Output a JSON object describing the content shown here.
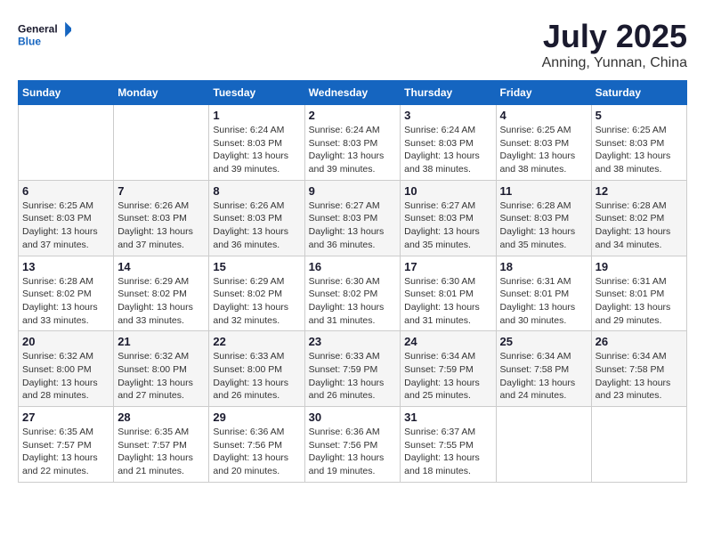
{
  "header": {
    "logo_line1": "General",
    "logo_line2": "Blue",
    "month_year": "July 2025",
    "location": "Anning, Yunnan, China"
  },
  "weekdays": [
    "Sunday",
    "Monday",
    "Tuesday",
    "Wednesday",
    "Thursday",
    "Friday",
    "Saturday"
  ],
  "weeks": [
    [
      {
        "day": "",
        "info": ""
      },
      {
        "day": "",
        "info": ""
      },
      {
        "day": "1",
        "info": "Sunrise: 6:24 AM\nSunset: 8:03 PM\nDaylight: 13 hours and 39 minutes."
      },
      {
        "day": "2",
        "info": "Sunrise: 6:24 AM\nSunset: 8:03 PM\nDaylight: 13 hours and 39 minutes."
      },
      {
        "day": "3",
        "info": "Sunrise: 6:24 AM\nSunset: 8:03 PM\nDaylight: 13 hours and 38 minutes."
      },
      {
        "day": "4",
        "info": "Sunrise: 6:25 AM\nSunset: 8:03 PM\nDaylight: 13 hours and 38 minutes."
      },
      {
        "day": "5",
        "info": "Sunrise: 6:25 AM\nSunset: 8:03 PM\nDaylight: 13 hours and 38 minutes."
      }
    ],
    [
      {
        "day": "6",
        "info": "Sunrise: 6:25 AM\nSunset: 8:03 PM\nDaylight: 13 hours and 37 minutes."
      },
      {
        "day": "7",
        "info": "Sunrise: 6:26 AM\nSunset: 8:03 PM\nDaylight: 13 hours and 37 minutes."
      },
      {
        "day": "8",
        "info": "Sunrise: 6:26 AM\nSunset: 8:03 PM\nDaylight: 13 hours and 36 minutes."
      },
      {
        "day": "9",
        "info": "Sunrise: 6:27 AM\nSunset: 8:03 PM\nDaylight: 13 hours and 36 minutes."
      },
      {
        "day": "10",
        "info": "Sunrise: 6:27 AM\nSunset: 8:03 PM\nDaylight: 13 hours and 35 minutes."
      },
      {
        "day": "11",
        "info": "Sunrise: 6:28 AM\nSunset: 8:03 PM\nDaylight: 13 hours and 35 minutes."
      },
      {
        "day": "12",
        "info": "Sunrise: 6:28 AM\nSunset: 8:02 PM\nDaylight: 13 hours and 34 minutes."
      }
    ],
    [
      {
        "day": "13",
        "info": "Sunrise: 6:28 AM\nSunset: 8:02 PM\nDaylight: 13 hours and 33 minutes."
      },
      {
        "day": "14",
        "info": "Sunrise: 6:29 AM\nSunset: 8:02 PM\nDaylight: 13 hours and 33 minutes."
      },
      {
        "day": "15",
        "info": "Sunrise: 6:29 AM\nSunset: 8:02 PM\nDaylight: 13 hours and 32 minutes."
      },
      {
        "day": "16",
        "info": "Sunrise: 6:30 AM\nSunset: 8:02 PM\nDaylight: 13 hours and 31 minutes."
      },
      {
        "day": "17",
        "info": "Sunrise: 6:30 AM\nSunset: 8:01 PM\nDaylight: 13 hours and 31 minutes."
      },
      {
        "day": "18",
        "info": "Sunrise: 6:31 AM\nSunset: 8:01 PM\nDaylight: 13 hours and 30 minutes."
      },
      {
        "day": "19",
        "info": "Sunrise: 6:31 AM\nSunset: 8:01 PM\nDaylight: 13 hours and 29 minutes."
      }
    ],
    [
      {
        "day": "20",
        "info": "Sunrise: 6:32 AM\nSunset: 8:00 PM\nDaylight: 13 hours and 28 minutes."
      },
      {
        "day": "21",
        "info": "Sunrise: 6:32 AM\nSunset: 8:00 PM\nDaylight: 13 hours and 27 minutes."
      },
      {
        "day": "22",
        "info": "Sunrise: 6:33 AM\nSunset: 8:00 PM\nDaylight: 13 hours and 26 minutes."
      },
      {
        "day": "23",
        "info": "Sunrise: 6:33 AM\nSunset: 7:59 PM\nDaylight: 13 hours and 26 minutes."
      },
      {
        "day": "24",
        "info": "Sunrise: 6:34 AM\nSunset: 7:59 PM\nDaylight: 13 hours and 25 minutes."
      },
      {
        "day": "25",
        "info": "Sunrise: 6:34 AM\nSunset: 7:58 PM\nDaylight: 13 hours and 24 minutes."
      },
      {
        "day": "26",
        "info": "Sunrise: 6:34 AM\nSunset: 7:58 PM\nDaylight: 13 hours and 23 minutes."
      }
    ],
    [
      {
        "day": "27",
        "info": "Sunrise: 6:35 AM\nSunset: 7:57 PM\nDaylight: 13 hours and 22 minutes."
      },
      {
        "day": "28",
        "info": "Sunrise: 6:35 AM\nSunset: 7:57 PM\nDaylight: 13 hours and 21 minutes."
      },
      {
        "day": "29",
        "info": "Sunrise: 6:36 AM\nSunset: 7:56 PM\nDaylight: 13 hours and 20 minutes."
      },
      {
        "day": "30",
        "info": "Sunrise: 6:36 AM\nSunset: 7:56 PM\nDaylight: 13 hours and 19 minutes."
      },
      {
        "day": "31",
        "info": "Sunrise: 6:37 AM\nSunset: 7:55 PM\nDaylight: 13 hours and 18 minutes."
      },
      {
        "day": "",
        "info": ""
      },
      {
        "day": "",
        "info": ""
      }
    ]
  ]
}
